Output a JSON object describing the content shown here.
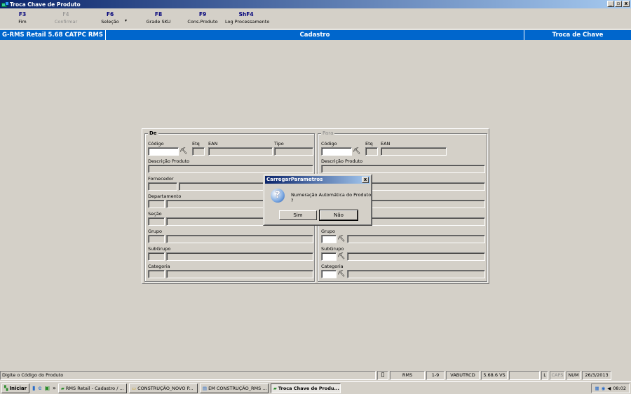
{
  "window": {
    "title": "Troca Chave de Produto",
    "buttons": [
      "_",
      "▫",
      "x"
    ]
  },
  "toolbar": [
    {
      "key": "F3",
      "label": "Fim",
      "enabled": true
    },
    {
      "key": "F4",
      "label": "Confirmar",
      "enabled": false
    },
    {
      "key": "F6",
      "label": "Seleção",
      "enabled": true
    },
    {
      "key": "F8",
      "label": "Grade SKU",
      "enabled": true
    },
    {
      "key": "F9",
      "label": "Cons.Produto",
      "enabled": true
    },
    {
      "key": "ShF4",
      "label": "Log Processamento",
      "enabled": true
    }
  ],
  "header": {
    "app": "G-RMS Retail 5.68 CATPC RMS",
    "module": "Cadastro",
    "screen": "Troca de Chave"
  },
  "form": {
    "de": {
      "title": "De",
      "codigo": "Código",
      "etq": "Etq",
      "ean": "EAN",
      "tipo": "Tipo",
      "descricao": "Descrição Produto",
      "fornecedor": "Fornecedor",
      "departamento": "Departamento",
      "secao": "Seção",
      "grupo": "Grupo",
      "subgrupo": "SubGrupo",
      "categoria": "Categoria"
    },
    "para": {
      "title": "Para",
      "codigo": "Código",
      "etq": "Etq",
      "ean": "EAN",
      "descricao": "Descrição Produto",
      "grupo": "Grupo",
      "subgrupo": "SubGrupo",
      "categoria": "Categoria"
    }
  },
  "dialog": {
    "title": "CarregarParametros",
    "message": "Numeração Automática do Produto ?",
    "yes": "Sim",
    "no": "Não",
    "close": "x"
  },
  "status": {
    "hint": "Digite o Código do Produto",
    "cells": [
      "RMS",
      "1-9",
      "VABUTRCD",
      "5.68.6 VS",
      "",
      "L",
      "CAPS",
      "NUM",
      "26/3/2013"
    ]
  },
  "taskbar": {
    "start": "Iniciar",
    "items": [
      {
        "label": "RMS Retail - Cadastro / ...",
        "active": false
      },
      {
        "label": "CONSTRUÇÃO_NOVO P...",
        "active": false
      },
      {
        "label": "EM CONSTRUÇÃO_RMS ...",
        "active": false
      },
      {
        "label": "Troca Chave de Produ...",
        "active": true
      }
    ],
    "chevron": "»",
    "clock": "08:02"
  }
}
